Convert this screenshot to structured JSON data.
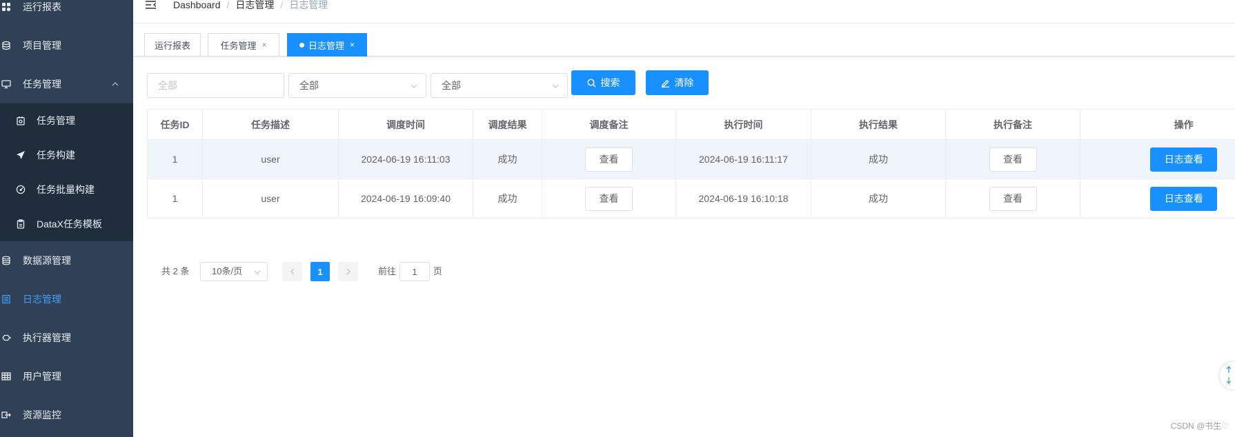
{
  "sidebar": {
    "items": [
      {
        "label": "运行报表",
        "icon": "chart-icon"
      },
      {
        "label": "项目管理",
        "icon": "project-icon"
      },
      {
        "label": "任务管理",
        "icon": "monitor-icon",
        "expanded": true,
        "children": [
          {
            "label": "任务管理",
            "icon": "task-icon"
          },
          {
            "label": "任务构建",
            "icon": "send-icon"
          },
          {
            "label": "任务批量构建",
            "icon": "gauge-icon"
          },
          {
            "label": "DataX任务模板",
            "icon": "clipboard-icon"
          }
        ]
      },
      {
        "label": "数据源管理",
        "icon": "database-icon"
      },
      {
        "label": "日志管理",
        "icon": "log-icon",
        "active": true
      },
      {
        "label": "执行器管理",
        "icon": "executor-icon"
      },
      {
        "label": "用户管理",
        "icon": "user-grid-icon"
      },
      {
        "label": "资源监控",
        "icon": "resource-icon"
      }
    ]
  },
  "navbar": {
    "breadcrumb": [
      "Dashboard",
      "日志管理",
      "日志管理"
    ],
    "separator": "/"
  },
  "tags": [
    {
      "label": "运行报表",
      "closable": false,
      "active": false
    },
    {
      "label": "任务管理",
      "closable": true,
      "active": false
    },
    {
      "label": "日志管理",
      "closable": true,
      "active": true
    }
  ],
  "close_glyph": "×",
  "filters": {
    "keyword": {
      "value": "",
      "placeholder": "全部"
    },
    "select_1": {
      "value": "全部"
    },
    "select_2": {
      "value": "全部"
    },
    "search_label": "搜索",
    "clear_label": "清除"
  },
  "table": {
    "columns": [
      "任务ID",
      "任务描述",
      "调度时间",
      "调度结果",
      "调度备注",
      "执行时间",
      "执行结果",
      "执行备注",
      "操作"
    ],
    "rows": [
      {
        "task_id": 1,
        "task_desc": "user",
        "schedule_time": "2024-06-19 16:11:03",
        "schedule_result": "成功",
        "schedule_note_action": "查看",
        "exec_time": "2024-06-19 16:11:17",
        "exec_result": "成功",
        "exec_note_action": "查看",
        "log_action": "日志查看",
        "highlighted": true
      },
      {
        "task_id": 1,
        "task_desc": "user",
        "schedule_time": "2024-06-19 16:09:40",
        "schedule_result": "成功",
        "schedule_note_action": "查看",
        "exec_time": "2024-06-19 16:10:18",
        "exec_result": "成功",
        "exec_note_action": "查看",
        "log_action": "日志查看",
        "highlighted": false
      }
    ]
  },
  "pagination": {
    "total_text": "共 2 条",
    "page_size": "10条/页",
    "current_page": "1",
    "goto_prefix": "前往",
    "goto_value": "1",
    "goto_suffix": "页"
  },
  "watermark": "CSDN @书生♡",
  "colors": {
    "sidebar_bg": "#304156",
    "submenu_bg": "#1f2d3d",
    "accent": "#1890ff",
    "active_menu_text": "#409eff",
    "highlight_row": "#f0f5fb"
  }
}
